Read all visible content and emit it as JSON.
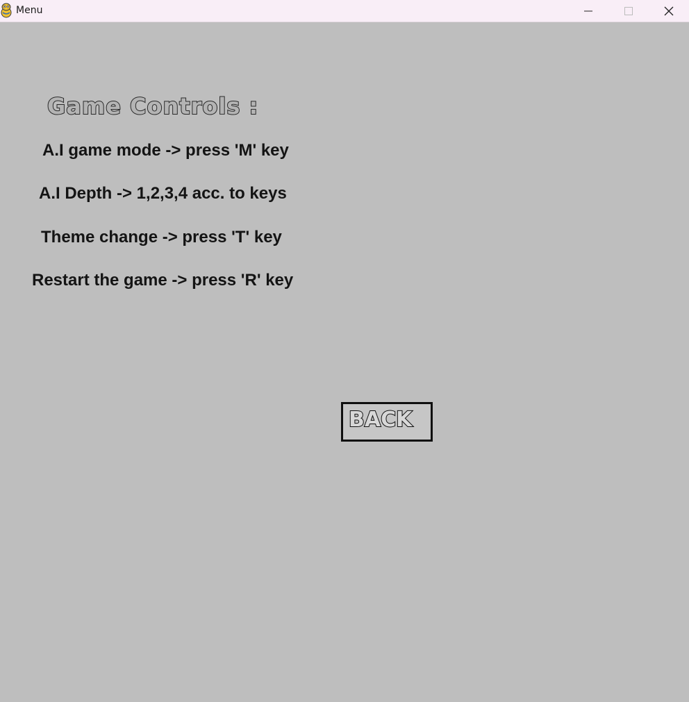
{
  "window": {
    "title": "Menu",
    "app_icon": "pygame-snake-icon",
    "controls": {
      "minimize_icon": "minimize-icon",
      "maximize_icon": "maximize-icon",
      "close_icon": "close-icon"
    }
  },
  "colors": {
    "background": "#bebebe",
    "titlebar": "#f9eef7",
    "text": "#141414",
    "button_border": "#0f0f0f"
  },
  "menu": {
    "heading": "Game Controls :",
    "controls": [
      "A.I game mode -> press 'M' key",
      "A.I Depth -> 1,2,3,4 acc. to keys",
      "Theme change -> press 'T' key",
      "Restart the game -> press 'R' key"
    ],
    "back_label": "BACK"
  }
}
